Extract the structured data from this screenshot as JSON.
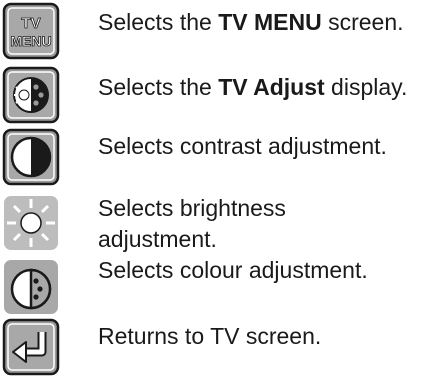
{
  "rows": [
    {
      "icon": "tv-menu-icon",
      "icon_text_top": "TV",
      "icon_text_bottom": "MENU",
      "pre": "Selects the ",
      "bold": "TV MENU",
      "post": " screen."
    },
    {
      "icon": "tv-adjust-icon",
      "pre": "Selects the ",
      "bold": "TV Adjust",
      "post": " display."
    },
    {
      "icon": "contrast-icon",
      "text": "Selects contrast adjustment."
    },
    {
      "icon": "brightness-icon",
      "line1": "Selects brightness",
      "line2": "adjustment."
    },
    {
      "icon": "colour-icon",
      "text": "Selects colour adjustment."
    },
    {
      "icon": "return-icon",
      "text": "Returns to TV screen."
    }
  ]
}
